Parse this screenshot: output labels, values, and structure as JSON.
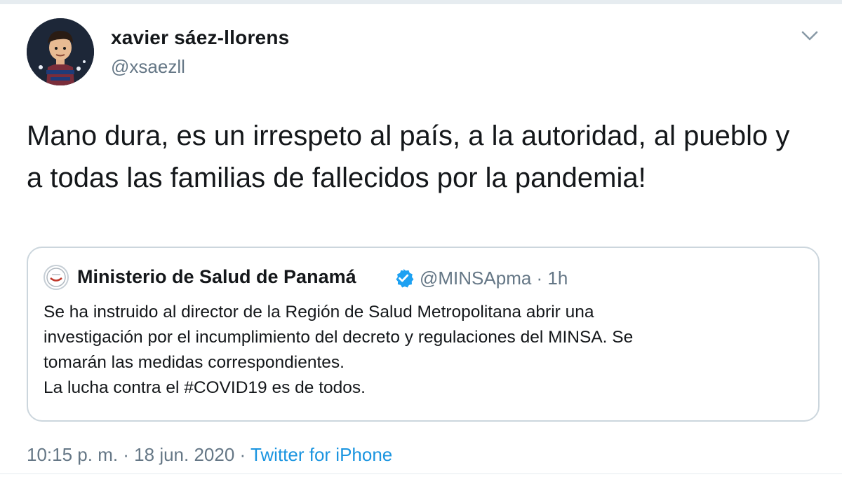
{
  "author": {
    "name": "xavier sáez-llorens",
    "handle": "@xsaezll"
  },
  "tweet": {
    "text": "Mano dura, es un irrespeto al país, a la autoridad, al pueblo y a todas las familias de fallecidos por la pandemia!"
  },
  "quoted": {
    "name": "Ministerio de Salud de Panamá",
    "handle": "@MINSApma · 1h",
    "lines": [
      "Se ha instruido al director de la Región de Salud Metropolitana abrir una",
      "investigación por el incumplimiento del decreto y regulaciones del MINSA. Se",
      "tomarán las medidas correspondientes.",
      "La lucha contra el #COVID19 es de todos."
    ]
  },
  "meta": {
    "time": "10:15 p. m. · 18 jun. 2020 · ",
    "source": "Twitter for iPhone"
  },
  "colors": {
    "text": "#14171a",
    "secondary": "#657786",
    "link": "#1b95e0",
    "border": "#ccd6dd"
  },
  "icons": {
    "caret": "chevron-down-icon",
    "verified": "verified-badge-icon"
  }
}
